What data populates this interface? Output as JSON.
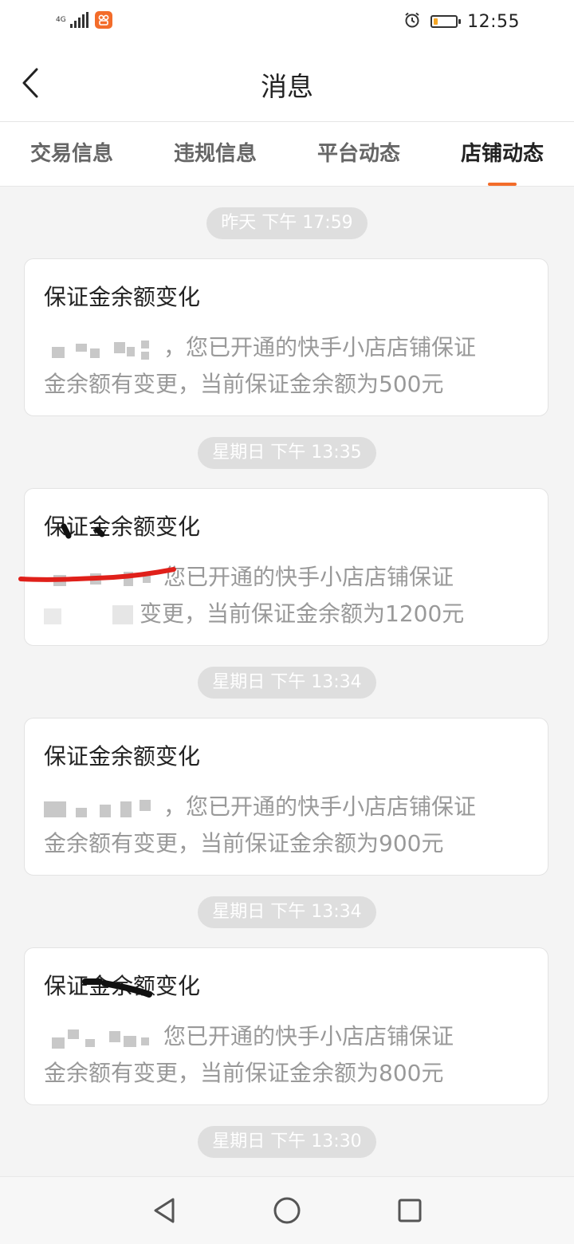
{
  "status_bar": {
    "network": "4G",
    "time": "12:55",
    "battery_level": 0.2
  },
  "header": {
    "title": "消息",
    "back_icon": "chevron-left-icon"
  },
  "tabs": [
    {
      "label": "交易信息",
      "active": false
    },
    {
      "label": "违规信息",
      "active": false
    },
    {
      "label": "平台动态",
      "active": false
    },
    {
      "label": "店铺动态",
      "active": true
    }
  ],
  "colors": {
    "accent": "#f36c2a",
    "timestamp_bg": "#dedede"
  },
  "messages": [
    {
      "timestamp": "昨天 下午 17:59",
      "title": "保证金余额变化",
      "body_line1": "，您已开通的快手小店店铺保证",
      "body_line2": "金余额有变更，当前保证金余额为500元"
    },
    {
      "timestamp": "星期日 下午 13:35",
      "title": "保证金余额变化",
      "body_line1": "您已开通的快手小店店铺保证",
      "body_line2": "变更，当前保证金余额为1200元"
    },
    {
      "timestamp": "星期日 下午 13:34",
      "title": "保证金余额变化",
      "body_line1": "，您已开通的快手小店店铺保证",
      "body_line2": "金余额有变更，当前保证金余额为900元"
    },
    {
      "timestamp": "星期日 下午 13:34",
      "title": "保证金余额变化",
      "body_line1": "您已开通的快手小店店铺保证",
      "body_line2": "金余额有变更，当前保证金余额为800元"
    },
    {
      "timestamp": "星期日 下午 13:30"
    }
  ],
  "nav_bar": {
    "back_icon": "triangle-back-icon",
    "home_icon": "circle-home-icon",
    "recents_icon": "square-recents-icon"
  }
}
